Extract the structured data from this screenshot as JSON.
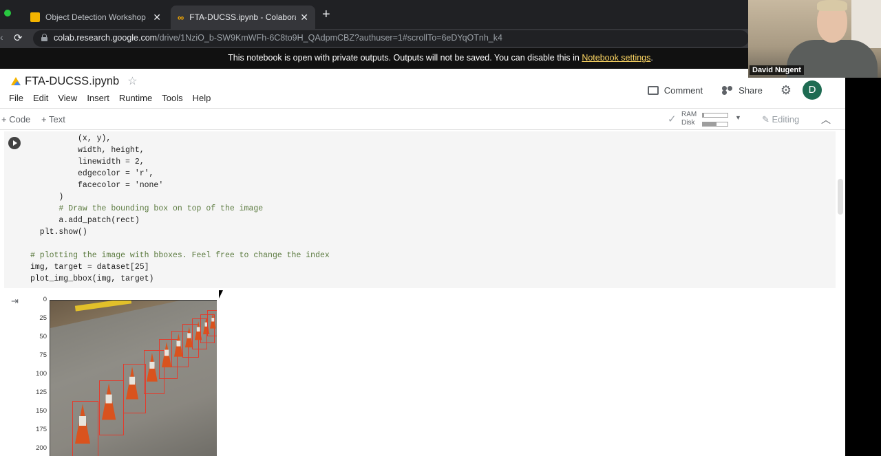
{
  "browser": {
    "tabs": [
      {
        "label": "Object Detection Workshop Se",
        "active": false
      },
      {
        "label": "FTA-DUCSS.ipynb - Colaborat",
        "active": true
      }
    ],
    "url_host": "colab.research.google.com",
    "url_path": "/drive/1NziO_b-SW9KmWFh-6C8to9H_QAdpmCBZ?authuser=1#scrollTo=6eDYqOTnh_k4"
  },
  "banner": {
    "text": "This notebook is open with private outputs. Outputs will not be saved. You can disable this in ",
    "link": "Notebook settings",
    "end": "."
  },
  "webcam": {
    "name": "David Nugent"
  },
  "notebook": {
    "title": "FTA-DUCSS.ipynb",
    "menu": [
      "File",
      "Edit",
      "View",
      "Insert",
      "Runtime",
      "Tools",
      "Help"
    ],
    "comment": "Comment",
    "share": "Share",
    "avatar_letter": "D"
  },
  "toolbar": {
    "code": "+ Code",
    "text": "+ Text",
    "ram": "RAM",
    "disk": "Disk",
    "ram_fraction": 0.05,
    "disk_fraction": 0.55,
    "editing": "Editing"
  },
  "code_lines": [
    "    (x, y),",
    "    width, height,",
    "    linewidth = 2,",
    "    edgecolor = 'r',",
    "    facecolor = 'none'",
    "  )",
    "  # Draw the bounding box on top of the image",
    "  a.add_patch(rect)",
    "plt.show()",
    "",
    "# plotting the image with bboxes. Feel free to change the index",
    "img, target = dataset[25]",
    "plot_img_bbox(img, target)"
  ],
  "output": {
    "y_ticks": [
      "0",
      "25",
      "50",
      "75",
      "100",
      "125",
      "150",
      "175",
      "200"
    ]
  }
}
